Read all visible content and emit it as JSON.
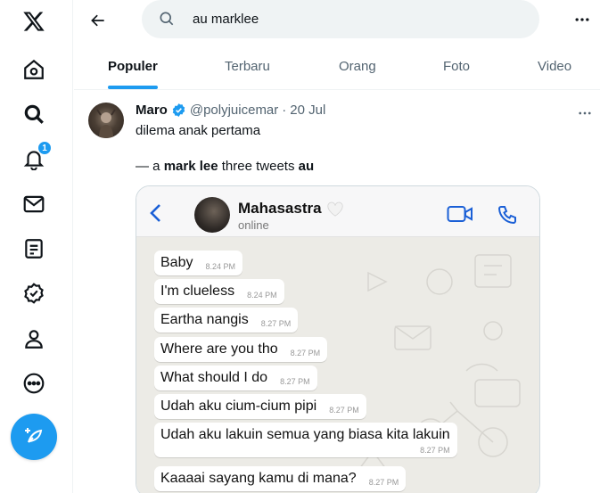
{
  "nav": {
    "notification_count": "1"
  },
  "search": {
    "query": "au marklee"
  },
  "tabs": [
    {
      "label": "Populer"
    },
    {
      "label": "Terbaru"
    },
    {
      "label": "Orang"
    },
    {
      "label": "Foto"
    },
    {
      "label": "Video"
    }
  ],
  "tweet": {
    "author_name": "Maro",
    "handle": "@polyjuicemar",
    "separator": "·",
    "date": "20 Jul",
    "text_line1": "dilema anak pertama",
    "text_line2_prefix": "— a ",
    "text_line2_bold1": "mark lee",
    "text_line2_mid": " three tweets ",
    "text_line2_bold2": "au"
  },
  "chat": {
    "contact_name": "Mahasastra",
    "status": "online",
    "messages": [
      {
        "text": "Baby",
        "time": "8.24 PM"
      },
      {
        "text": "I'm clueless",
        "time": "8.24 PM"
      },
      {
        "text": "Eartha nangis",
        "time": "8.27 PM"
      },
      {
        "text": "Where are you tho",
        "time": "8.27 PM"
      },
      {
        "text": "What should I do",
        "time": "8.27 PM"
      },
      {
        "text": "Udah aku cium-cium pipi",
        "time": "8.27 PM"
      },
      {
        "text": "Udah aku lakuin semua yang biasa kita lakuin",
        "time": "8.27 PM"
      },
      {
        "text": "Kaaaai sayang kamu di mana?",
        "time": "8.27 PM"
      }
    ]
  },
  "colors": {
    "accent": "#1d9bf0",
    "text_primary": "#0f1419",
    "text_secondary": "#536471",
    "chat_blue": "#1a5fd6",
    "chat_bg": "#ecebe6"
  }
}
